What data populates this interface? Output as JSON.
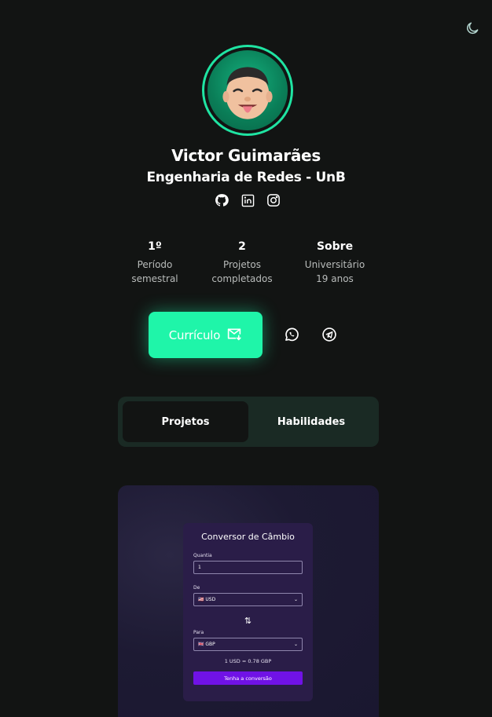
{
  "profile": {
    "name": "Victor Guimarães",
    "subtitle": "Engenharia de Redes - UnB"
  },
  "icons": {
    "theme": "moon-icon",
    "socials": [
      "github-icon",
      "linkedin-icon",
      "instagram-icon"
    ],
    "contact": [
      "whatsapp-icon",
      "telegram-icon"
    ]
  },
  "stats": [
    {
      "value": "1º",
      "label": "Período\nsemestral"
    },
    {
      "value": "2",
      "label": "Projetos\ncompletados"
    },
    {
      "value": "Sobre",
      "label": "Universitário\n19 anos"
    }
  ],
  "cv_button": {
    "label": "Currículo"
  },
  "tabs": [
    {
      "label": "Projetos",
      "active": true
    },
    {
      "label": "Habilidades",
      "active": false
    }
  ],
  "project_preview": {
    "title": "Conversor de Câmbio",
    "amount_label": "Quantia",
    "amount_value": "1",
    "from_label": "De",
    "from_value": "🇺🇸 USD",
    "to_label": "Para",
    "to_value": "🇬🇧 GBP",
    "rate": "1 USD = 0.78 GBP",
    "button": "Tenha a conversão"
  },
  "colors": {
    "background": "#121413",
    "accent": "#1ff5a9",
    "tabs_bg": "#1a2a24",
    "converter_button": "#7012e6"
  }
}
